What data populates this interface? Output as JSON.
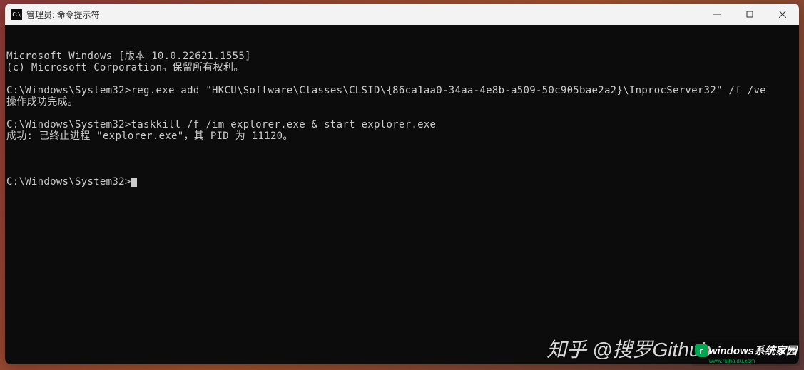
{
  "titlebar": {
    "icon_text": "C:\\",
    "title": "管理员: 命令提示符"
  },
  "terminal": {
    "lines": [
      "Microsoft Windows [版本 10.0.22621.1555]",
      "(c) Microsoft Corporation。保留所有权利。",
      "",
      "C:\\Windows\\System32>reg.exe add \"HKCU\\Software\\Classes\\CLSID\\{86ca1aa0-34aa-4e8b-a509-50c905bae2a2}\\InprocServer32\" /f /ve",
      "操作成功完成。",
      "",
      "C:\\Windows\\System32>taskkill /f /im explorer.exe & start explorer.exe",
      "成功: 已终止进程 \"explorer.exe\"，其 PID 为 11120。",
      ""
    ],
    "prompt": "C:\\Windows\\System32>"
  },
  "watermarks": {
    "zhihu": "知乎 @搜罗Github",
    "windows_logo_letter": "r",
    "windows_text": "windows系统家园",
    "windows_sub": "www.ruihaidu.com"
  }
}
